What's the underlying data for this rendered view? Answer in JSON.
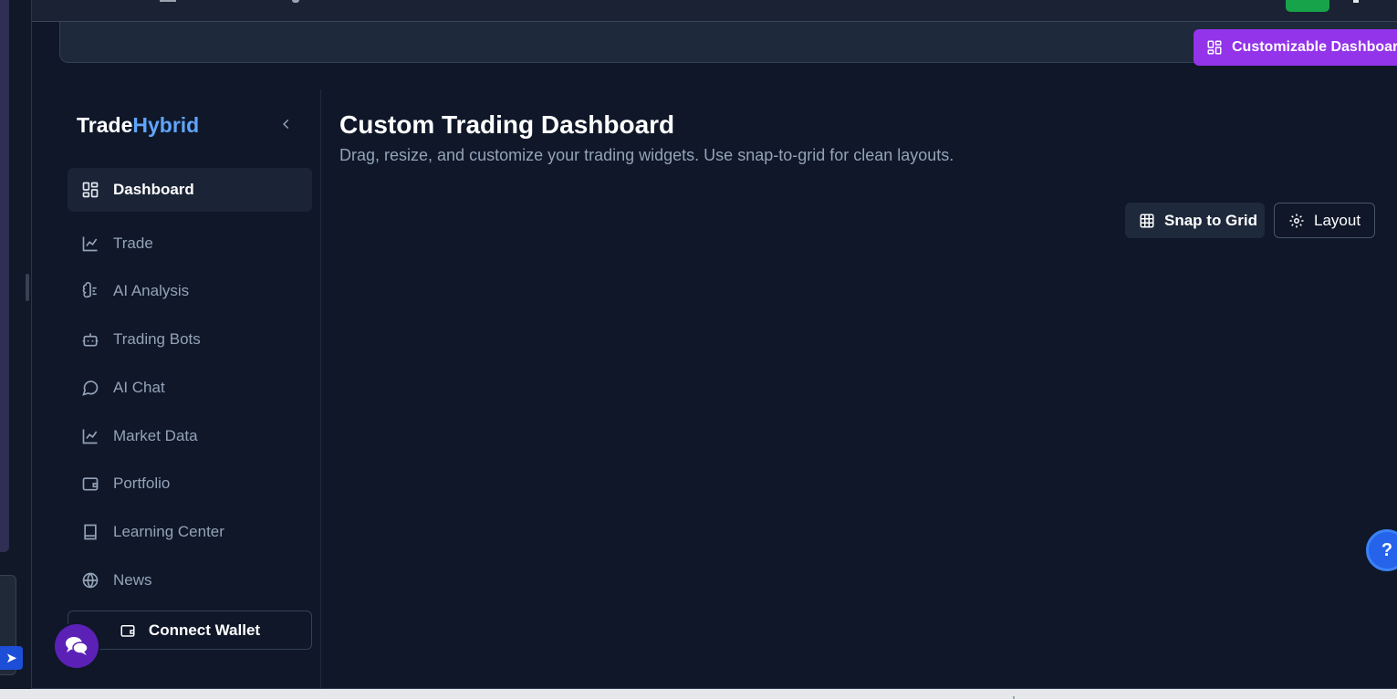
{
  "header": {
    "customizable_label": "Customizable Dashboard"
  },
  "sidebar": {
    "brand_part1": "Trade",
    "brand_part2": "Hybrid",
    "items": [
      {
        "label": "Dashboard",
        "icon": "layout-dashboard-icon"
      },
      {
        "label": "Trade",
        "icon": "line-chart-icon"
      },
      {
        "label": "AI Analysis",
        "icon": "brain-icon"
      },
      {
        "label": "Trading Bots",
        "icon": "bot-icon"
      },
      {
        "label": "AI Chat",
        "icon": "message-circle-icon"
      },
      {
        "label": "Market Data",
        "icon": "line-chart-icon"
      },
      {
        "label": "Portfolio",
        "icon": "wallet-icon"
      },
      {
        "label": "Learning Center",
        "icon": "book-icon"
      },
      {
        "label": "News",
        "icon": "globe-icon"
      }
    ],
    "connect_wallet": "Connect Wallet"
  },
  "main": {
    "title": "Custom Trading Dashboard",
    "subtitle": "Drag, resize, and customize your trading widgets. Use snap-to-grid for clean layouts.",
    "snap_label": "Snap to Grid",
    "layout_label": "Layout"
  },
  "help_label": "?",
  "colors": {
    "background": "#0f1729",
    "accent_blue": "#60a5fa",
    "purple": "#9333ea",
    "green": "#16a34a",
    "help_blue": "#2563eb"
  }
}
